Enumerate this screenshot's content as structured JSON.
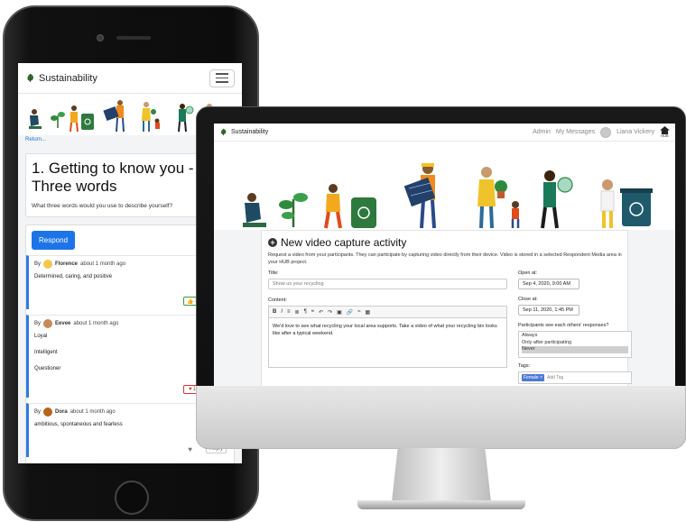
{
  "colors": {
    "primary": "#1d74e8",
    "accent_teal": "#2d95c4",
    "like_green": "#3a9a3a",
    "love_red": "#d33333",
    "tag_blue": "#4c79d6"
  },
  "phone": {
    "brand": "Sustainability",
    "brand_icon": "leaf-icon",
    "menu_icon": "hamburger-icon",
    "return_link": "Return...",
    "return_right": "Y",
    "question_title": "1. Getting to know you - Three words",
    "question_text": "What three words would you use to describe yourself?",
    "respond_label": "Respond",
    "responses": [
      {
        "by": "By",
        "author": "Florence",
        "time": "about 1 month ago",
        "lines": [
          "Determined, caring, and positive"
        ],
        "reaction": "like",
        "reaction_count": "1"
      },
      {
        "by": "By",
        "author": "Eevee",
        "time": "about 1 month ago",
        "lines": [
          "Loyal",
          "Intelligent",
          "Questioner"
        ],
        "reaction": "love",
        "reaction_count": "1"
      },
      {
        "by": "By",
        "author": "Dora",
        "time": "about 1 month ago",
        "lines": [
          "ambitious, spontaneous and fearless"
        ],
        "reply_label": "Reply"
      }
    ]
  },
  "desktop": {
    "brand": "Sustainability",
    "nav": {
      "admin": "Admin",
      "messages": "My Messages",
      "user": "Liana Vickery",
      "home_caption": "HUB"
    },
    "activity": {
      "title": "New video capture activity",
      "description": "Request a video from your participants. They can participate by capturing video directly from their device. Video is stored in a selected Respondent Media area in your HUB project.",
      "title_label": "Title:",
      "title_placeholder": "Show us your recycling",
      "content_label": "Content:",
      "content_text": "We'd love to see what recycling your local area supports. Take a video of what your recycling bin looks like after a typical weekend.",
      "open_label": "Open at:",
      "open_value": "Sep 4, 2020, 9:00 AM",
      "close_label": "Close at:",
      "close_value": "Sep 11, 2020, 1:45 PM",
      "visibility_label": "Participants see each others' responses?",
      "visibility_options": [
        "Always",
        "Only after participating",
        "Never"
      ],
      "visibility_selected": "Never",
      "tags_label": "Tags:",
      "tag": "Female",
      "tag_placeholder": "Add Tag"
    }
  }
}
